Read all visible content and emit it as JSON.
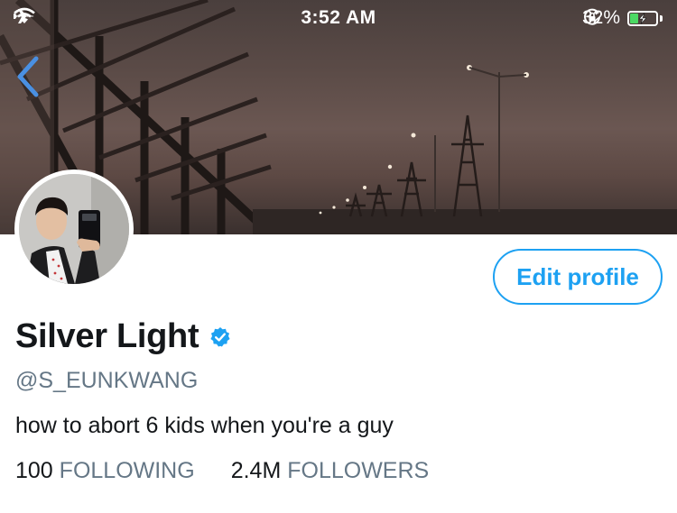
{
  "status_bar": {
    "time": "3:52 AM",
    "battery_percent": "32%",
    "battery_level": 0.32,
    "icons": [
      "airplane-icon",
      "wifi-icon",
      "rotation-lock-icon",
      "battery-charging-icon"
    ]
  },
  "header": {
    "back_icon": "chevron-left-icon"
  },
  "profile": {
    "display_name": "Silver Light",
    "verified_icon": "verified-badge-icon",
    "handle": "@S_EUNKWANG",
    "bio": "how to abort 6 kids when you're a guy",
    "following_count": "100",
    "following_label": "FOLLOWING",
    "followers_count": "2.4M",
    "followers_label": "FOLLOWERS"
  },
  "actions": {
    "edit_profile_label": "Edit profile"
  },
  "colors": {
    "accent": "#1da1f2",
    "text_primary": "#14171a",
    "text_secondary": "#657786",
    "battery_fill": "#4cd964"
  }
}
